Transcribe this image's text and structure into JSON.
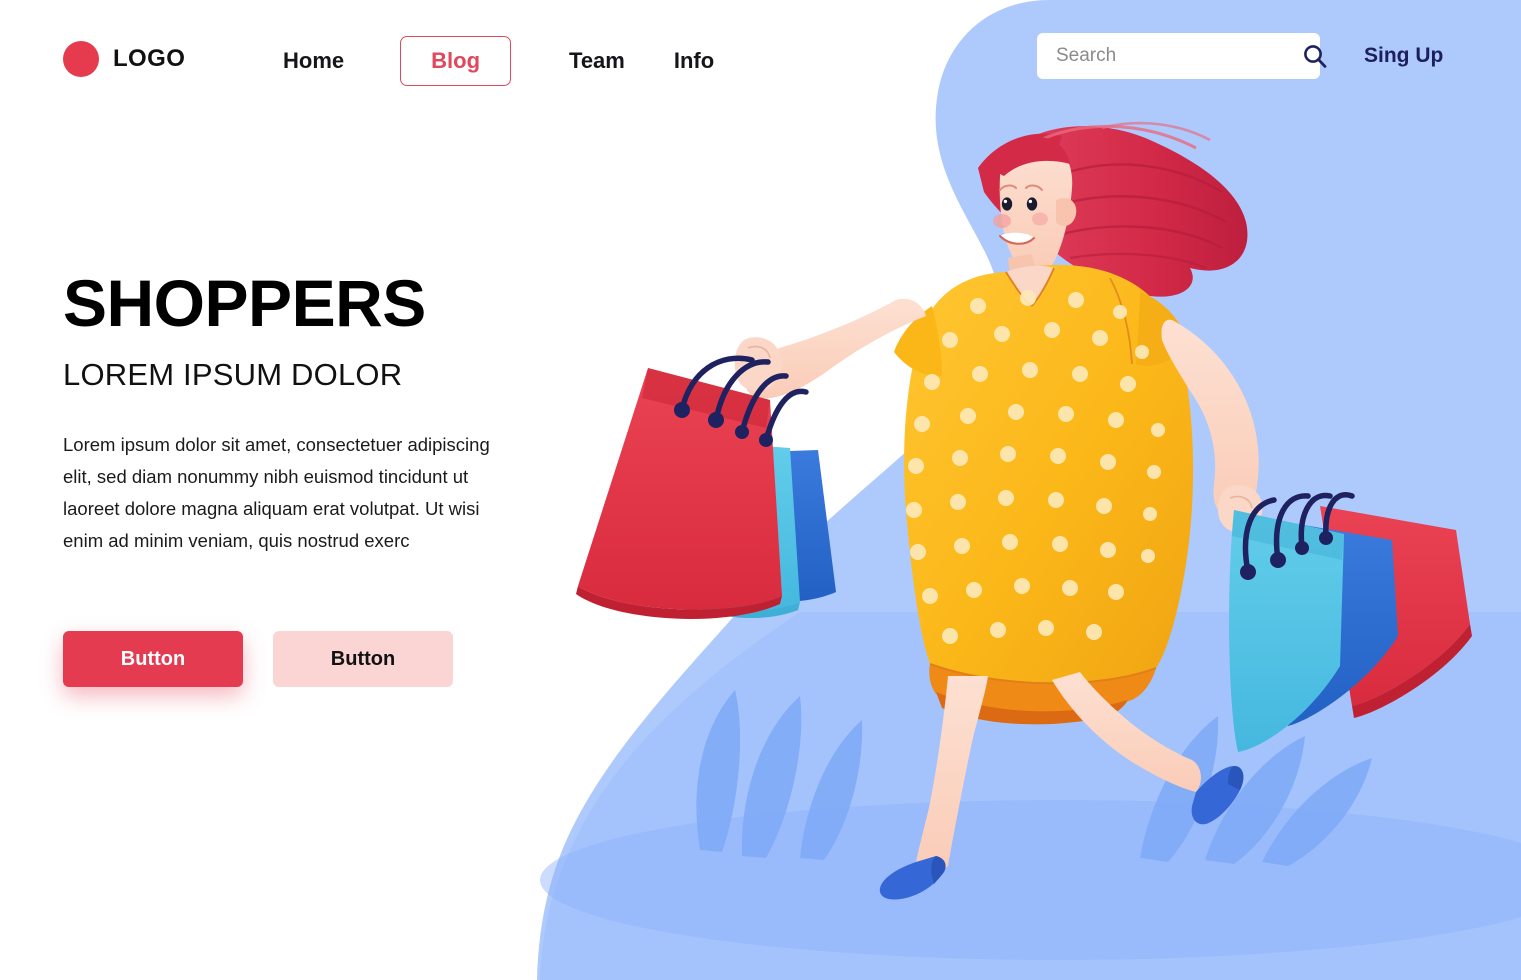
{
  "brand": {
    "logo_text": "LOGO",
    "logo_icon": "circle-dot-icon",
    "accent_red": "#E43B50",
    "accent_red_soft": "#FBD4D4",
    "navy": "#1d1f5c",
    "bg_blue": "#AEC9FC",
    "bg_blue_deep": "#83ADFB"
  },
  "nav": {
    "items": [
      {
        "label": "Home",
        "active": false
      },
      {
        "label": "Blog",
        "active": true
      },
      {
        "label": "Team",
        "active": false
      },
      {
        "label": "Info",
        "active": false
      }
    ]
  },
  "search": {
    "placeholder": "Search",
    "value": "",
    "icon": "search-icon"
  },
  "auth": {
    "signup_label": "Sing Up"
  },
  "hero": {
    "title": "SHOPPERS",
    "subtitle": "LOREM IPSUM DOLOR",
    "body": "Lorem ipsum dolor sit amet, consectetuer adipiscing elit, sed diam nonummy nibh euismod tincidunt ut laoreet dolore magna aliquam erat volutpat. Ut wisi enim ad minim veniam, quis nostrud exerc",
    "primary_button": "Button",
    "secondary_button": "Button"
  },
  "illustration": {
    "name": "woman-running-with-shopping-bags",
    "hair_color": "#D32A48",
    "dress_color": "#FBB718",
    "dress_hem_color": "#F08A17",
    "skin_color": "#FBD7C8",
    "shoe_color": "#3567D6",
    "bag_red": "#E23A4B",
    "bag_blue_light": "#4EC3E8",
    "bag_blue_royal": "#2B6FD4",
    "handle_navy": "#1F2260"
  }
}
